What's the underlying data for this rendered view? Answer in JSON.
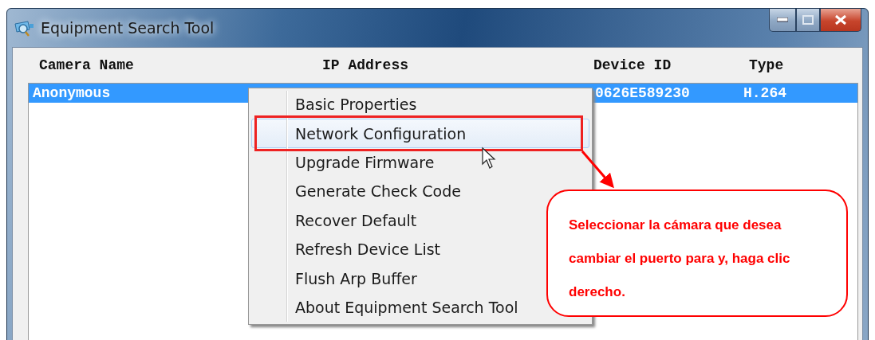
{
  "window": {
    "title": "Equipment Search Tool"
  },
  "table": {
    "columns": [
      "Camera Name",
      "IP Address",
      "Device ID",
      "Type"
    ],
    "rows": [
      {
        "camera_name": "Anonymous",
        "device_id": "0626E589230",
        "type": "H.264",
        "selected": true
      }
    ]
  },
  "context_menu": {
    "items": [
      {
        "label": "Basic Properties",
        "selected": false
      },
      {
        "label": "Network Configuration",
        "selected": true
      },
      {
        "label": "Upgrade Firmware",
        "selected": false
      },
      {
        "label": "Generate Check Code",
        "selected": false
      },
      {
        "label": "Recover Default",
        "selected": false
      },
      {
        "label": "Refresh Device List",
        "selected": false
      },
      {
        "label": "Flush Arp Buffer",
        "selected": false
      },
      {
        "label": "About Equipment Search Tool",
        "selected": false
      }
    ]
  },
  "callout": {
    "text": "Seleccionar la cámara que desea cambiar el puerto para y, haga clic derecho."
  }
}
